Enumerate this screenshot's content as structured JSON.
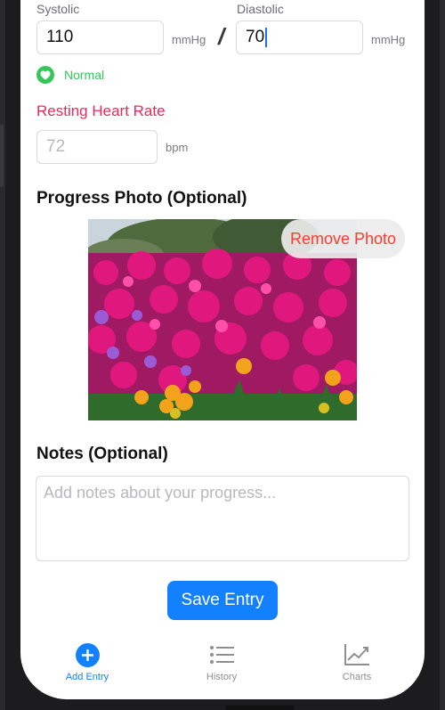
{
  "blood_pressure": {
    "systolic_label": "Systolic",
    "systolic_value": "110",
    "systolic_unit": "mmHg",
    "diastolic_label": "Diastolic",
    "diastolic_value": "70",
    "diastolic_unit": "mmHg",
    "separator": "/",
    "status": "Normal",
    "status_color": "#34c759"
  },
  "heart_rate": {
    "title": "Resting Heart Rate",
    "placeholder": "72",
    "unit": "bpm"
  },
  "photo": {
    "title": "Progress Photo (Optional)",
    "remove_label": "Remove Photo"
  },
  "notes": {
    "title": "Notes (Optional)",
    "placeholder": "Add notes about your progress..."
  },
  "actions": {
    "save_label": "Save Entry"
  },
  "tab_bar": {
    "items": [
      {
        "label": "Add Entry",
        "icon": "plus-circle-icon",
        "active": true
      },
      {
        "label": "History",
        "icon": "list-icon",
        "active": false
      },
      {
        "label": "Charts",
        "icon": "chart-line-icon",
        "active": false
      }
    ]
  },
  "colors": {
    "accent": "#1381ff",
    "heart_rate_title": "#e8295a",
    "remove": "#ff3b30"
  }
}
